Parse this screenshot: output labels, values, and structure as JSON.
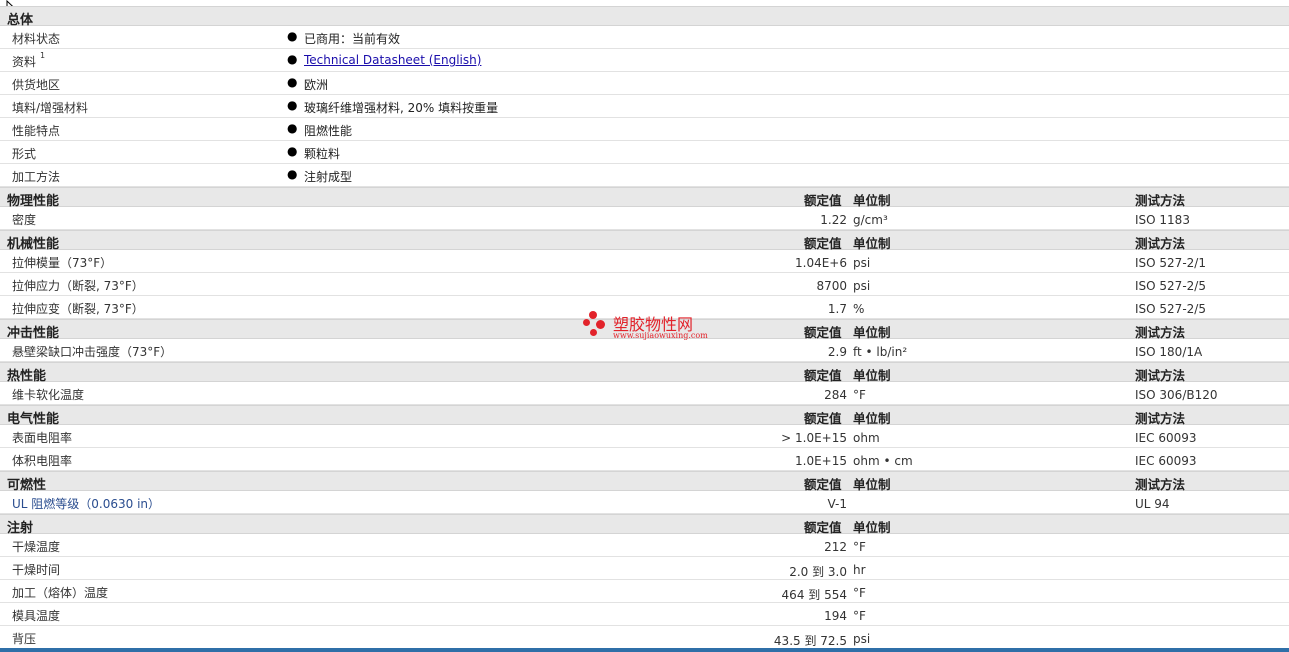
{
  "general": {
    "title": "总体",
    "rows": [
      {
        "name": "材料状态",
        "value": "已商用：当前有效"
      },
      {
        "name": "资料",
        "sup": "1",
        "link": "Technical Datasheet (English)"
      },
      {
        "name": "供货地区",
        "value": "欧洲"
      },
      {
        "name": "填料/增强材料",
        "value": "玻璃纤维增强材料, 20% 填料按重量"
      },
      {
        "name": "性能特点",
        "value": "阻燃性能"
      },
      {
        "name": "形式",
        "value": "颗粒料"
      },
      {
        "name": "加工方法",
        "value": "注射成型"
      }
    ]
  },
  "headers": {
    "rated": "额定值",
    "unit": "单位制",
    "test": "测试方法"
  },
  "sections": [
    {
      "title": "物理性能",
      "test": true,
      "rows": [
        {
          "name": "密度",
          "value": "1.22",
          "unit": "g/cm³",
          "test": "ISO 1183"
        }
      ]
    },
    {
      "title": "机械性能",
      "test": true,
      "rows": [
        {
          "name": "拉伸模量（73°F）",
          "value": "1.04E+6",
          "unit": "psi",
          "test": "ISO 527-2/1"
        },
        {
          "name": "拉伸应力（断裂, 73°F）",
          "value": "8700",
          "unit": "psi",
          "test": "ISO 527-2/5"
        },
        {
          "name": "拉伸应变（断裂, 73°F）",
          "value": "1.7",
          "unit": "%",
          "test": "ISO 527-2/5"
        }
      ]
    },
    {
      "title": "冲击性能",
      "test": true,
      "rows": [
        {
          "name": "悬壁梁缺口冲击强度（73°F）",
          "value": "2.9",
          "unit": "ft • lb/in²",
          "test": "ISO 180/1A"
        }
      ]
    },
    {
      "title": "热性能",
      "test": true,
      "rows": [
        {
          "name": "维卡软化温度",
          "value": "284",
          "unit": "°F",
          "test": "ISO 306/B120"
        }
      ]
    },
    {
      "title": "电气性能",
      "test": true,
      "rows": [
        {
          "name": "表面电阻率",
          "value": "> 1.0E+15",
          "unit": "ohm",
          "test": "IEC 60093"
        },
        {
          "name": "体积电阻率",
          "value": "1.0E+15",
          "unit": "ohm • cm",
          "test": "IEC 60093"
        }
      ]
    },
    {
      "title": "可燃性",
      "test": true,
      "rows": [
        {
          "name": "UL 阻燃等级（0.0630 in）",
          "value": "V-1",
          "unit": "",
          "test": "UL 94",
          "blue": true
        }
      ]
    },
    {
      "title": "注射",
      "test": false,
      "rows": [
        {
          "name": "干燥温度",
          "value": "212",
          "unit": "°F",
          "test": ""
        },
        {
          "name": "干燥时间",
          "value": "2.0 到  3.0",
          "unit": "hr",
          "test": ""
        },
        {
          "name": "加工（熔体）温度",
          "value": "464 到  554",
          "unit": "°F",
          "test": ""
        },
        {
          "name": "模具温度",
          "value": "194",
          "unit": "°F",
          "test": ""
        },
        {
          "name": "背压",
          "value": "43.5 到  72.5",
          "unit": "psi",
          "test": ""
        }
      ]
    }
  ],
  "watermark": {
    "text": "塑胶物性网",
    "url": "www.sujiaowuxing.com",
    "color": "#e2232b"
  }
}
